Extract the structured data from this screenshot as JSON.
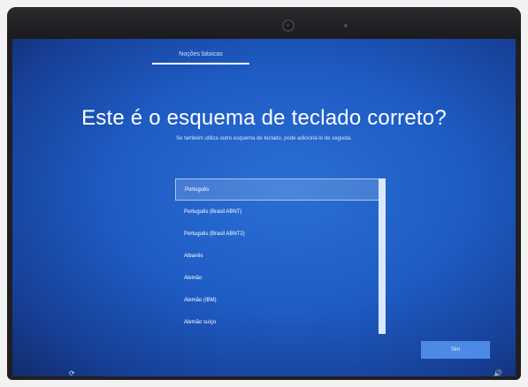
{
  "header": {
    "tab_label": "Noções básicas"
  },
  "main": {
    "title": "Este é o esquema de teclado correto?",
    "subtitle": "Se também utiliza outro esquema de teclado, pode adicioná-lo de seguida."
  },
  "keyboard_list": {
    "items": [
      {
        "label": "Português",
        "selected": true
      },
      {
        "label": "Português (Brasil ABNT)",
        "selected": false
      },
      {
        "label": "Português (Brasil ABNT2)",
        "selected": false
      },
      {
        "label": "Albanês",
        "selected": false
      },
      {
        "label": "Alemão",
        "selected": false
      },
      {
        "label": "Alemão (IBM)",
        "selected": false
      },
      {
        "label": "Alemão suíço",
        "selected": false
      }
    ]
  },
  "footer": {
    "next_label": "Sim",
    "accessibility_icon": "ease-of-access-icon",
    "volume_icon": "volume-icon"
  },
  "colors": {
    "background_accent": "#1e5cc4",
    "button": "#4c8ae6"
  }
}
